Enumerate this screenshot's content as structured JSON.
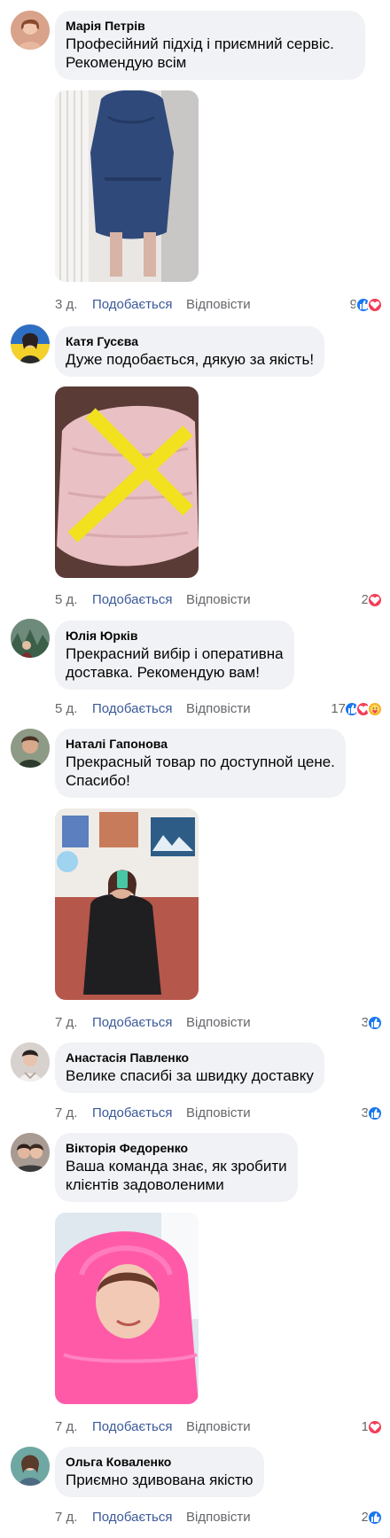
{
  "labels": {
    "like": "Подобається",
    "reply": "Відповісти"
  },
  "comments": [
    {
      "author": "Марія Петрів",
      "text_lines": [
        "Професійний підхід і приємний сервіс.",
        "Рекомендую всім"
      ],
      "time": "3 д.",
      "reaction_count": "9",
      "reactions": [
        "like-icon",
        "love-icon"
      ],
      "has_photo": true
    },
    {
      "author": "Катя Гусєва",
      "text_lines": [
        "Дуже подобається, дякую за якість!"
      ],
      "time": "5 д.",
      "reaction_count": "2",
      "reactions": [
        "love-icon"
      ],
      "has_photo": true
    },
    {
      "author": "Юлія Юрків",
      "text_lines": [
        "Прекрасний вибір і оперативна",
        "доставка. Рекомендую вам!"
      ],
      "time": "5 д.",
      "reaction_count": "17",
      "reactions": [
        "like-icon",
        "love-icon",
        "care-icon"
      ],
      "has_photo": false
    },
    {
      "author": "Наталі Гапонова",
      "text_lines": [
        "Прекрасный товар по доступной цене.",
        "Спасибо!"
      ],
      "time": "7 д.",
      "reaction_count": "3",
      "reactions": [
        "like-icon"
      ],
      "has_photo": true
    },
    {
      "author": "Анастасія Павленко",
      "text_lines": [
        "Велике спасибі за швидку доставку"
      ],
      "time": "7 д.",
      "reaction_count": "3",
      "reactions": [
        "like-icon"
      ],
      "has_photo": false
    },
    {
      "author": "Вікторія Федоренко",
      "text_lines": [
        "Ваша команда знає, як зробити",
        "клієнтів задоволеними"
      ],
      "time": "7 д.",
      "reaction_count": "1",
      "reactions": [
        "love-icon"
      ],
      "has_photo": true
    },
    {
      "author": "Ольга Коваленко",
      "text_lines": [
        "Приємно здивована якістю"
      ],
      "time": "7 д.",
      "reaction_count": "2",
      "reactions": [
        "like-icon"
      ],
      "has_photo": false
    }
  ],
  "colors": {
    "bubble": "#f0f2f5",
    "like_link": "#3b5998",
    "muted": "#65676b",
    "like_reaction": "#1877f2",
    "love_reaction": "#f33e58",
    "care_reaction": "#f7b125"
  }
}
